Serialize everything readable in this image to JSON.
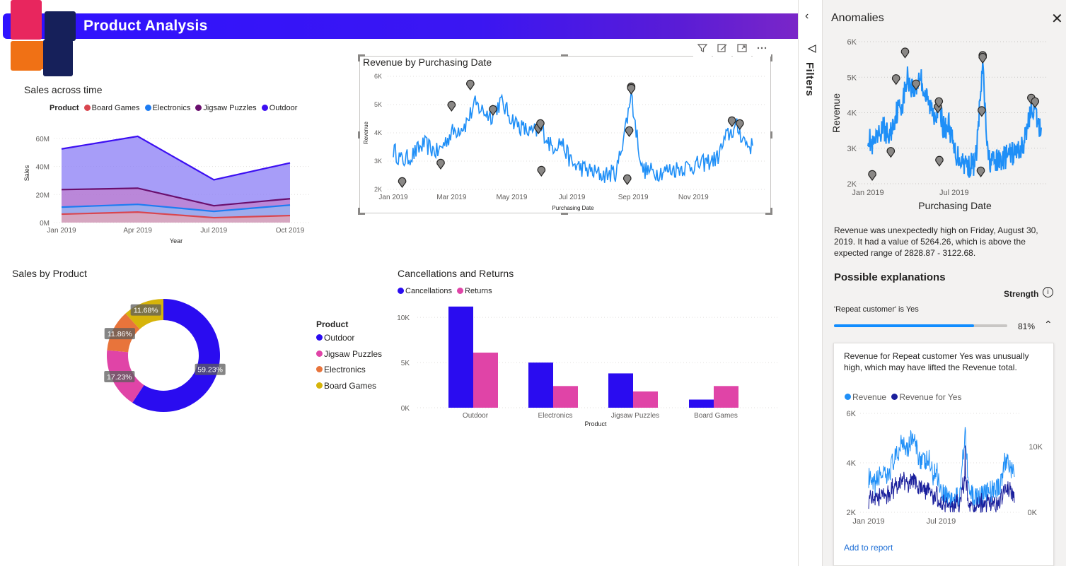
{
  "header": {
    "title": "Product Analysis"
  },
  "colors": {
    "board_games": "#d9464f",
    "electronics": "#1d7cf2",
    "jigsaw": "#6a0f6e",
    "outdoor": "#3c0ff2",
    "revenue_line": "#1f8ff7",
    "cancellations": "#2a0cf0",
    "returns": "#e044a7",
    "donut_outdoor": "#2a0cf0",
    "donut_jigsaw": "#e044a7",
    "donut_electronics": "#e8743b",
    "donut_board": "#d6b40a"
  },
  "visual_toolbar": {
    "icons": [
      "filter-icon",
      "focus-mode-icon",
      "expand-icon",
      "more-options-icon"
    ]
  },
  "sales_time": {
    "title": "Sales across time",
    "legend_title": "Product",
    "legend": [
      "Board Games",
      "Electronics",
      "Jigsaw Puzzles",
      "Outdoor"
    ],
    "chart_data": {
      "type": "area",
      "title": "Sales across time",
      "xlabel": "Year",
      "ylabel": "Sales",
      "categories": [
        "Jan 2019",
        "Apr 2019",
        "Jul 2019",
        "Oct 2019"
      ],
      "ylim": [
        0,
        70
      ],
      "yticks": [
        "0M",
        "20M",
        "40M",
        "60M"
      ],
      "series": [
        {
          "name": "Board Games",
          "values": [
            6,
            7.5,
            3.5,
            5
          ]
        },
        {
          "name": "Electronics",
          "values": [
            11,
            13,
            8,
            12.5
          ]
        },
        {
          "name": "Jigsaw Puzzles",
          "values": [
            23.5,
            24.5,
            12,
            17
          ]
        },
        {
          "name": "Outdoor",
          "values": [
            52.5,
            61.5,
            30.5,
            42.5
          ]
        }
      ]
    }
  },
  "revenue_date": {
    "title": "Revenue by Purchasing Date",
    "chart_data": {
      "type": "line",
      "title": "Revenue by Purchasing Date",
      "xlabel": "Purchasing Date",
      "ylabel": "Revenue",
      "x_ticks": [
        "Jan 2019",
        "Mar 2019",
        "May 2019",
        "Jul 2019",
        "Sep 2019",
        "Nov 2019"
      ],
      "x_range": [
        "2019-01-01",
        "2019-12-31"
      ],
      "ylim": [
        2000,
        6000
      ],
      "yticks": [
        "2K",
        "3K",
        "4K",
        "5K",
        "6K"
      ],
      "series": [
        {
          "name": "Revenue",
          "x": [
            "2019-01-01",
            "2019-01-10",
            "2019-01-20",
            "2019-02-01",
            "2019-02-15",
            "2019-03-01",
            "2019-03-15",
            "2019-03-25",
            "2019-04-01",
            "2019-04-10",
            "2019-04-20",
            "2019-05-01",
            "2019-05-10",
            "2019-05-20",
            "2019-06-01",
            "2019-06-10",
            "2019-06-20",
            "2019-07-01",
            "2019-07-15",
            "2019-08-01",
            "2019-08-15",
            "2019-08-30",
            "2019-09-10",
            "2019-09-25",
            "2019-10-10",
            "2019-10-25",
            "2019-11-10",
            "2019-11-25",
            "2019-12-05",
            "2019-12-15",
            "2019-12-25",
            "2019-12-31"
          ],
          "y": [
            3400,
            3000,
            3200,
            3600,
            3300,
            4000,
            4300,
            5000,
            4800,
            4600,
            5100,
            4500,
            4200,
            4000,
            4100,
            3500,
            3700,
            2900,
            2700,
            2500,
            2600,
            5264,
            2700,
            2600,
            2700,
            2800,
            2900,
            3100,
            3900,
            4200,
            3600,
            3500
          ]
        }
      ],
      "anomalies": [
        {
          "x": "2019-01-10",
          "y": 2100
        },
        {
          "x": "2019-02-18",
          "y": 2750
        },
        {
          "x": "2019-03-01",
          "y": 4800
        },
        {
          "x": "2019-03-20",
          "y": 5550
        },
        {
          "x": "2019-04-12",
          "y": 4650
        },
        {
          "x": "2019-05-28",
          "y": 4000
        },
        {
          "x": "2019-05-30",
          "y": 4150
        },
        {
          "x": "2019-05-31",
          "y": 2500
        },
        {
          "x": "2019-08-26",
          "y": 2200
        },
        {
          "x": "2019-08-28",
          "y": 3900
        },
        {
          "x": "2019-08-30",
          "y": 5450
        },
        {
          "x": "2019-08-30",
          "y": 5400
        },
        {
          "x": "2019-12-10",
          "y": 4250
        },
        {
          "x": "2019-12-18",
          "y": 4150
        }
      ]
    }
  },
  "sales_product": {
    "title": "Sales by Product",
    "legend_title": "Product",
    "legend": [
      "Outdoor",
      "Jigsaw Puzzles",
      "Electronics",
      "Board Games"
    ],
    "chart_data": {
      "type": "pie",
      "title": "Sales by Product",
      "categories": [
        "Outdoor",
        "Jigsaw Puzzles",
        "Electronics",
        "Board Games"
      ],
      "values": [
        59.23,
        17.23,
        11.86,
        11.68
      ],
      "labels": [
        "59.23%",
        "17.23%",
        "11.86%",
        "11.68%"
      ]
    }
  },
  "cancellations": {
    "title": "Cancellations and Returns",
    "legend": [
      "Cancellations",
      "Returns"
    ],
    "chart_data": {
      "type": "bar",
      "title": "Cancellations and Returns",
      "xlabel": "Product",
      "categories": [
        "Outdoor",
        "Electronics",
        "Jigsaw Puzzles",
        "Board Games"
      ],
      "ylim": [
        0,
        11500
      ],
      "yticks": [
        "0K",
        "5K",
        "10K"
      ],
      "series": [
        {
          "name": "Cancellations",
          "values": [
            11200,
            5000,
            3800,
            900
          ]
        },
        {
          "name": "Returns",
          "values": [
            6100,
            2400,
            1800,
            2400
          ]
        }
      ]
    }
  },
  "filters": {
    "label": "Filters"
  },
  "anomalies_pane": {
    "title": "Anomalies",
    "chart_data": {
      "type": "line",
      "xlabel": "Purchasing Date",
      "ylabel": "Revenue",
      "x_ticks": [
        "Jan 2019",
        "Jul 2019"
      ],
      "ylim": [
        2000,
        6000
      ],
      "yticks": [
        "2K",
        "3K",
        "4K",
        "5K",
        "6K"
      ]
    },
    "description": "Revenue was unexpectedly high on Friday, August 30, 2019. It had a value of 5264.26, which is above the expected range of 2828.87 - 3122.68.",
    "possible_explanations": "Possible explanations",
    "strength_label": "Strength",
    "info_icon": "info-icon",
    "explanation": {
      "label": "'Repeat customer' is Yes",
      "strength": 0.81,
      "strength_text": "81%",
      "card_text": "Revenue for Repeat customer Yes was unusually high, which may have lifted the Revenue total.",
      "legend": [
        "Revenue",
        "Revenue for Yes"
      ],
      "chart_data": {
        "type": "line",
        "x_ticks": [
          "Jan 2019",
          "Jul 2019"
        ],
        "y_left_ticks": [
          "2K",
          "4K",
          "6K"
        ],
        "y_right_ticks": [
          "0K",
          "10K"
        ],
        "series": [
          {
            "name": "Revenue",
            "axis": "left"
          },
          {
            "name": "Revenue for Yes",
            "axis": "right"
          }
        ]
      },
      "add_link": "Add to report"
    }
  }
}
